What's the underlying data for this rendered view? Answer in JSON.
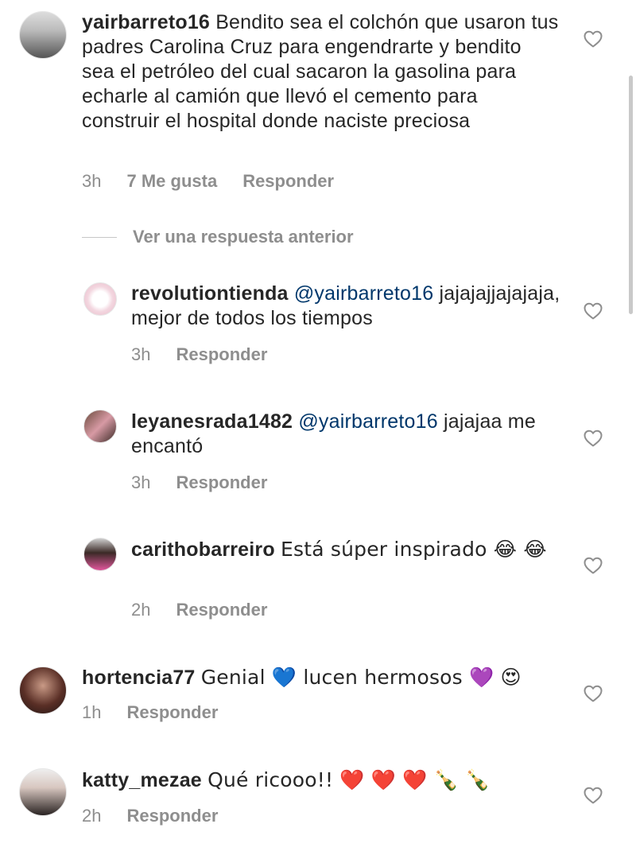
{
  "comments": [
    {
      "username": "yairbarreto16",
      "mention": "",
      "text": "Bendito sea el colchón que usaron tus padres Carolina Cruz para engendrarte y bendito sea el petróleo del cual sacaron la gasolina para echarle al camión que llevó el cemento para construir el hospital donde naciste preciosa",
      "time": "3h",
      "likes": "7 Me gusta",
      "reply": "Responder"
    },
    {
      "username": "revolutiontienda",
      "mention": "@yairbarreto16",
      "text": "jajajajjajajaja, mejor de todos los tiempos",
      "time": "3h",
      "reply": "Responder"
    },
    {
      "username": "leyanesrada1482",
      "mention": "@yairbarreto16",
      "text": "jajajaa me encantó",
      "time": "3h",
      "reply": "Responder"
    },
    {
      "username": "carithobarreiro",
      "mention": "",
      "text": "Está súper inspirado 😂 😂",
      "time": "2h",
      "reply": "Responder"
    },
    {
      "username": "hortencia77",
      "mention": "",
      "text": "Genial 💙 lucen hermosos 💜 😍",
      "time": "1h",
      "reply": "Responder"
    },
    {
      "username": "katty_mezae",
      "mention": "",
      "text": "Qué ricooo!! ❤️ ❤️ ❤️ 🍾 🍾",
      "time": "2h",
      "reply": "Responder"
    }
  ],
  "view_replies": "Ver una respuesta anterior",
  "icons": {
    "like": "heart-outline-icon"
  },
  "colors": {
    "mention": "#00376b",
    "meta": "#8e8e8e",
    "text": "#262626"
  }
}
